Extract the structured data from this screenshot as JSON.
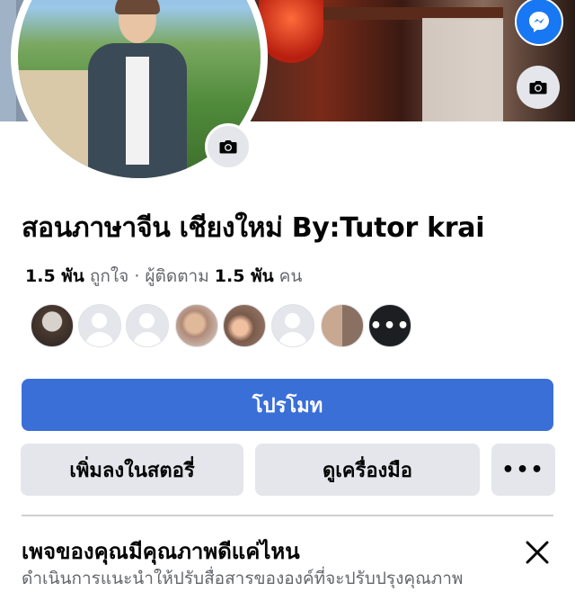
{
  "page": {
    "title": "สอนภาษาจีน เชียงใหม่ By:Tutor krai",
    "stats": {
      "likes_count": "1.5 พัน",
      "likes_label": "ถูกใจ",
      "separator": "·",
      "followers_label": "ผู้ติดตาม",
      "followers_count": "1.5 พัน",
      "followers_unit": "คน"
    }
  },
  "friends": {
    "avatars": [
      "photo",
      "default",
      "default",
      "photo",
      "photo",
      "default",
      "photo"
    ],
    "more_label": "•••"
  },
  "actions": {
    "promote_label": "โปรโมท",
    "add_story_label": "เพิ่มลงในสตอรี่",
    "view_tools_label": "ดูเครื่องมือ",
    "more_label": "•••"
  },
  "quality_card": {
    "title": "เพจของคุณมีคุณภาพดีแค่ไหน",
    "subtitle": "ดำเนินการแนะนำให้ปรับสื่อสารขององค์ที่จะปรับปรุงคุณภาพ"
  },
  "icons": {
    "camera": "camera-icon",
    "app_badge": "messenger-app-icon",
    "close": "close-icon"
  },
  "colors": {
    "primary": "#3a6fd8",
    "secondary_bg": "#e4e6eb",
    "text": "#050505",
    "muted": "#65676b"
  }
}
